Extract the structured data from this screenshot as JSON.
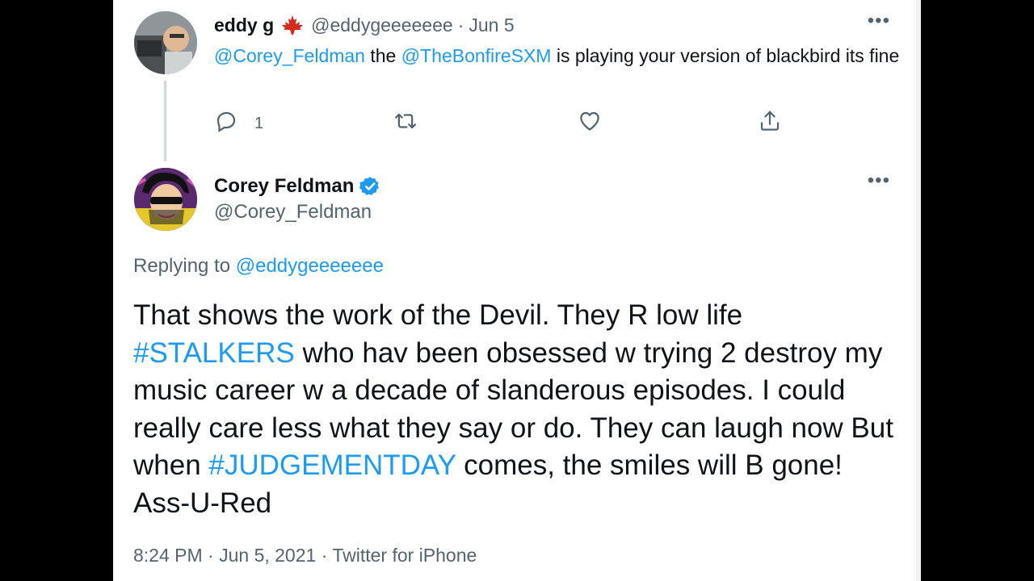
{
  "colors": {
    "link": "#1d9bf0",
    "muted": "#536471",
    "text": "#0f1419",
    "verified": "#1d9bf0",
    "flag": "#d52b1e"
  },
  "parent_tweet": {
    "name": "eddy g",
    "flag_icon": "canada-maple-leaf-icon",
    "handle": "@eddygeeeeeee",
    "dot": "·",
    "date": "Jun 5",
    "more_label": "•••",
    "text": {
      "mention1": "@Corey_Feldman",
      "t1": " the ",
      "mention2": "@TheBonfireSXM",
      "t2": " is playing your version of blackbird its fine"
    },
    "actions": {
      "reply_count": "1",
      "reply_icon": "reply-icon",
      "retweet_icon": "retweet-icon",
      "like_icon": "heart-icon",
      "share_icon": "share-icon"
    }
  },
  "main_tweet": {
    "name": "Corey Feldman",
    "verified_icon": "verified-badge-icon",
    "handle": "@Corey_Feldman",
    "more_label": "•••",
    "replying_prefix": "Replying to ",
    "replying_to": "@eddygeeeeeee",
    "text": {
      "t1": "That shows the work of the Devil. They R low life ",
      "hashtag1": "#STALKERS",
      "t2": " who hav been obsessed w trying 2 destroy my music career w a decade of slanderous episodes. I could really care less what they say or do. They can laugh now But when ",
      "hashtag2": "#JUDGEMENTDAY",
      "t3": " comes, the smiles will B gone! Ass-U-Red"
    },
    "meta": "8:24 PM · Jun 5, 2021 · Twitter for iPhone"
  }
}
